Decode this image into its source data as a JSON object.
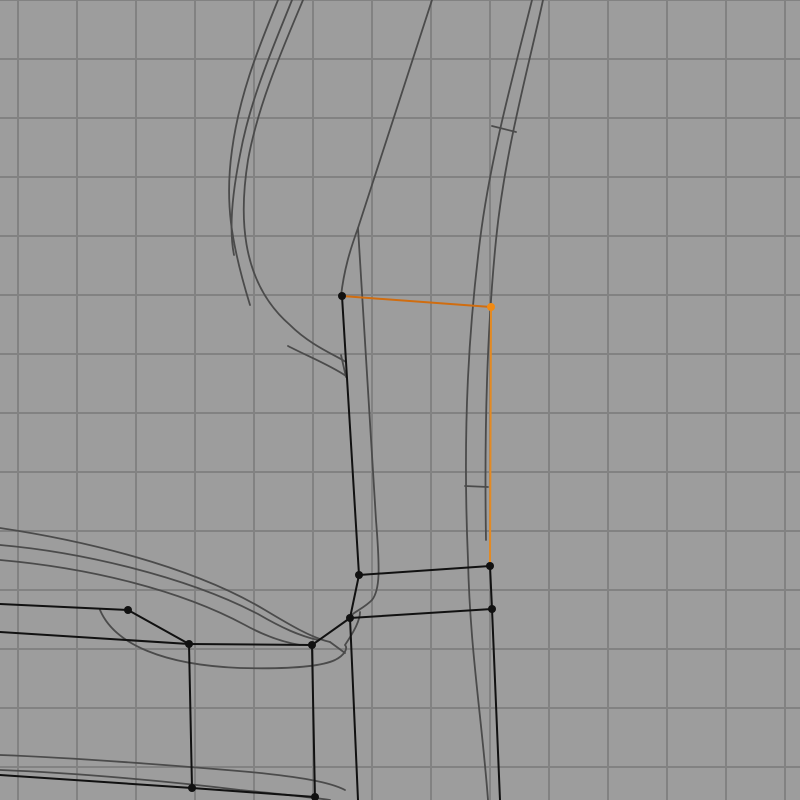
{
  "viewport": {
    "background_color": "#9d9d9d",
    "grid_color": "#828282",
    "reference_curve_color": "#4b4b4b",
    "edge_color": "#111111",
    "selected_color": "#f08a14"
  },
  "mesh": {
    "selected_vertex_count": 1,
    "selected_edge_count": 2
  }
}
